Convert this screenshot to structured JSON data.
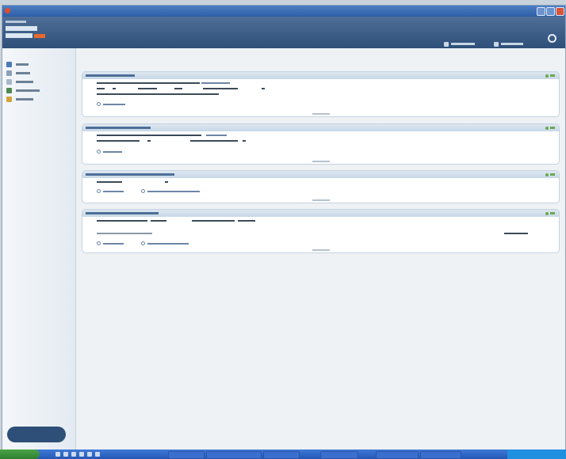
{
  "window": {
    "title": ""
  },
  "header": {
    "buttons": [
      {
        "label": ""
      },
      {
        "label": ""
      }
    ]
  },
  "sidebar": {
    "items": [
      {
        "label": "",
        "icon": "status-icon"
      },
      {
        "label": "",
        "icon": "scan-icon"
      },
      {
        "label": "",
        "icon": "reports-icon"
      },
      {
        "label": "",
        "icon": "quarantine-icon"
      },
      {
        "label": "",
        "icon": "services-icon"
      }
    ]
  },
  "main": {
    "page_title": "",
    "sections": [
      {
        "title": "",
        "status": ""
      },
      {
        "title": "",
        "status": ""
      },
      {
        "title": "",
        "status": ""
      },
      {
        "title": "",
        "status": ""
      }
    ]
  },
  "taskbar": {
    "start_label": ""
  },
  "colors": {
    "title_bar": "#2d5ea6",
    "header": "#2e4f78",
    "status_ok": "#6aa84f",
    "accent_orange": "#e8692c"
  }
}
